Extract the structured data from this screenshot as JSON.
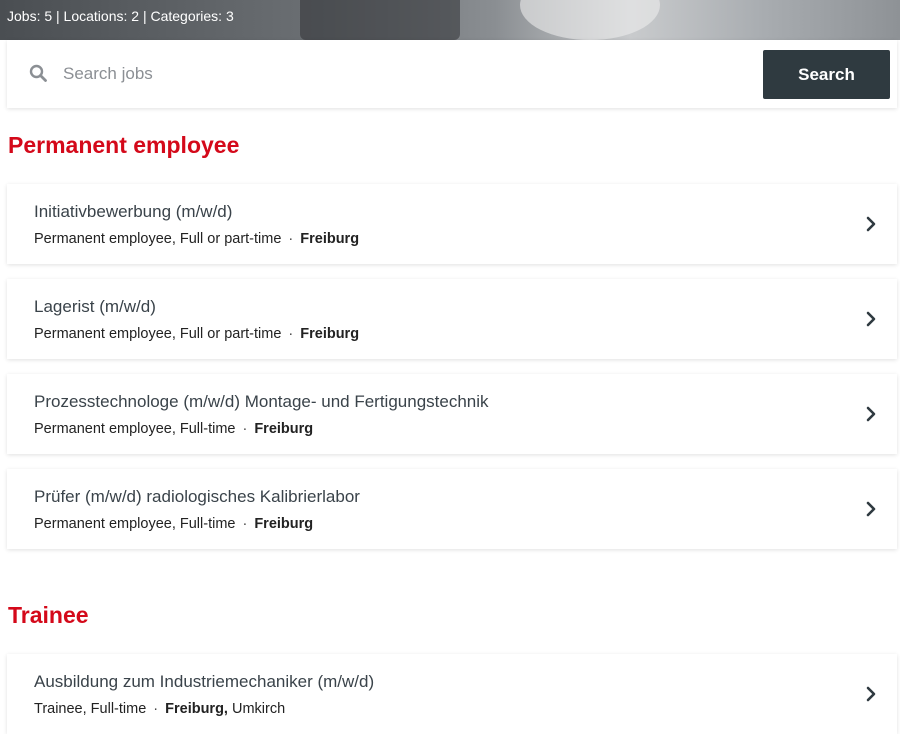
{
  "header": {
    "stats": "Jobs: 5 | Locations: 2 | Categories: 3"
  },
  "search": {
    "placeholder": "Search jobs",
    "button_label": "Search"
  },
  "sections": [
    {
      "title": "Permanent employee",
      "jobs": [
        {
          "title": "Initiativbewerbung (m/w/d)",
          "type": "Permanent employee, Full or part-time",
          "location": "Freiburg",
          "extra_location": ""
        },
        {
          "title": "Lagerist (m/w/d)",
          "type": "Permanent employee, Full or part-time",
          "location": "Freiburg",
          "extra_location": ""
        },
        {
          "title": "Prozesstechnologe (m/w/d) Montage- und Fertigungstechnik",
          "type": "Permanent employee, Full-time",
          "location": "Freiburg",
          "extra_location": ""
        },
        {
          "title": "Prüfer (m/w/d) radiologisches Kalibrierlabor",
          "type": "Permanent employee, Full-time",
          "location": "Freiburg",
          "extra_location": ""
        }
      ]
    },
    {
      "title": "Trainee",
      "jobs": [
        {
          "title": "Ausbildung zum Industriemechaniker (m/w/d)",
          "type": "Trainee, Full-time",
          "location": "Freiburg,",
          "extra_location": "Umkirch"
        }
      ]
    }
  ],
  "separator": "·",
  "colors": {
    "accent": "#d4091a",
    "button_bg": "#2f3a40",
    "title_text": "#3a434a"
  },
  "icons": {
    "search": "search-icon",
    "chevron": "chevron-right-icon"
  }
}
